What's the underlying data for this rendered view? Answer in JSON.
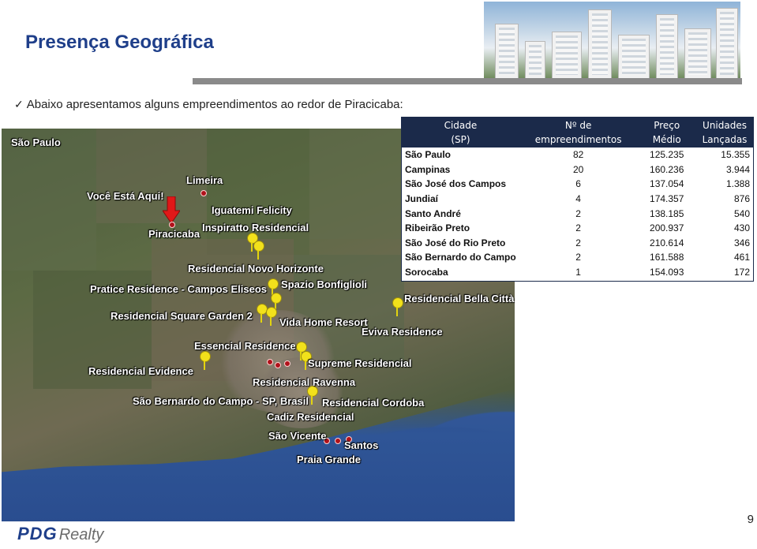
{
  "title": "Presença Geográfica",
  "bullet": {
    "icon": "checkmark-icon",
    "text": "Abaixo apresentamos alguns empreendimentos ao redor de Piracicaba:"
  },
  "map": {
    "labels": [
      "São Paulo",
      "Limeira",
      "Você Está Aqui!",
      "Iguatemi Felicity",
      "Inspiratto Residencial",
      "Piracicaba",
      "Residencial Novo Horizonte",
      "Pratice Residence - Campos Eliseos",
      "Spazio Bonfiglioli",
      "Residencial Bella Città",
      "Residencial Square Garden 2",
      "Vida Home Resort",
      "Eviva Residence",
      "Essencial Residence",
      "Residencial Evidence",
      "Supreme Residencial",
      "Residencial Ravenna",
      "São Bernardo do Campo - SP, Brasil",
      "Residencial Cordoba",
      "Cadiz Residencial",
      "São Vicente",
      "Santos",
      "Praia Grande"
    ],
    "colors": {
      "pin": "#f2e11b",
      "dot": "#b0121b",
      "arrow": "#e01818"
    }
  },
  "table": {
    "headers": [
      [
        "Cidade",
        "(SP)"
      ],
      [
        "Nº de",
        "empreendimentos"
      ],
      [
        "Preço",
        "Médio"
      ],
      [
        "Unidades",
        "Lançadas"
      ]
    ],
    "rows": [
      [
        "São Paulo",
        "82",
        "125.235",
        "15.355"
      ],
      [
        "Campinas",
        "20",
        "160.236",
        "3.944"
      ],
      [
        "São José dos Campos",
        "6",
        "137.054",
        "1.388"
      ],
      [
        "Jundiaí",
        "4",
        "174.357",
        "876"
      ],
      [
        "Santo André",
        "2",
        "138.185",
        "540"
      ],
      [
        "Ribeirão Preto",
        "2",
        "200.937",
        "430"
      ],
      [
        "São José do Rio Preto",
        "2",
        "210.614",
        "346"
      ],
      [
        "São Bernardo do Campo",
        "2",
        "161.588",
        "461"
      ],
      [
        "Sorocaba",
        "1",
        "154.093",
        "172"
      ]
    ],
    "header_color": "#1b2a4a"
  },
  "footer": {
    "logo_main": "PDG",
    "logo_sub": "Realty",
    "page_number": "9"
  }
}
